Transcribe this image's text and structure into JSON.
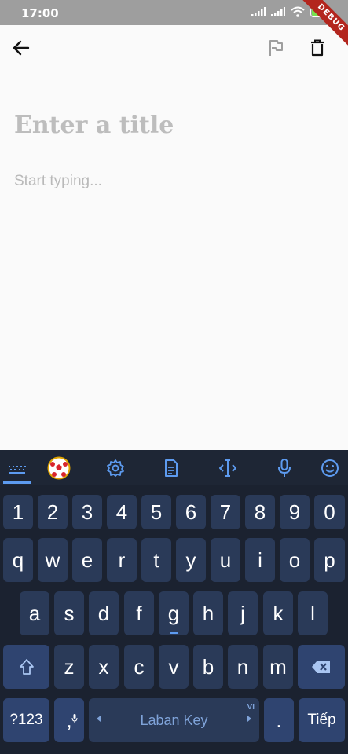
{
  "status_bar": {
    "time": "17:00",
    "battery_level": "70",
    "debug_label": "DEBUG"
  },
  "app_bar": {
    "back_icon": "arrow-left-icon",
    "flag_icon": "flag-outline-icon",
    "delete_icon": "trash-icon"
  },
  "editor": {
    "title_placeholder": "Enter a title",
    "body_placeholder": "Start typing..."
  },
  "keyboard": {
    "toolbar_icons": [
      "keyboard-icon",
      "soccer-ball-icon",
      "settings-icon",
      "clipboard-icon",
      "cursor-move-icon",
      "microphone-icon",
      "emoji-icon"
    ],
    "row_numbers": [
      "1",
      "2",
      "3",
      "4",
      "5",
      "6",
      "7",
      "8",
      "9",
      "0"
    ],
    "row1": [
      "q",
      "w",
      "e",
      "r",
      "t",
      "y",
      "u",
      "i",
      "o",
      "p"
    ],
    "row2": [
      "a",
      "s",
      "d",
      "f",
      "g",
      "h",
      "j",
      "k",
      "l"
    ],
    "row3": [
      "z",
      "x",
      "c",
      "v",
      "b",
      "n",
      "m"
    ],
    "symbols_key": "?123",
    "comma_key": ",",
    "space_label": "Laban Key",
    "language_badge": "VI",
    "period_key": ".",
    "enter_key": "Tiếp",
    "accent_color": "#5d9bf0",
    "key_color": "#2a3a58",
    "background_color": "#1b2230"
  }
}
